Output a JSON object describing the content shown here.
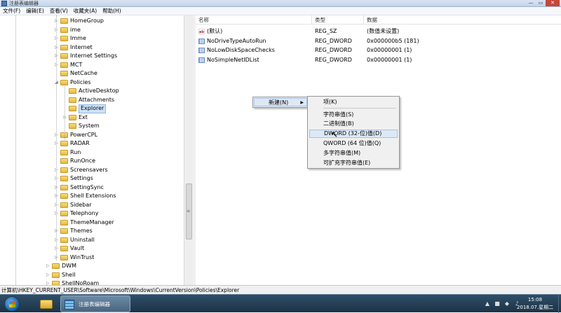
{
  "window": {
    "title": "注册表编辑器",
    "min": "—",
    "max": "▭",
    "close": "✕"
  },
  "menu": [
    "文件(F)",
    "编辑(E)",
    "查看(V)",
    "收藏夹(A)",
    "帮助(H)"
  ],
  "tree": {
    "items": [
      {
        "label": "HomeGroup",
        "level": 0,
        "expandable": true
      },
      {
        "label": "ime",
        "level": 0,
        "expandable": true
      },
      {
        "label": "Imme",
        "level": 0,
        "expandable": true
      },
      {
        "label": "Internet",
        "level": 0,
        "expandable": true
      },
      {
        "label": "Internet Settings",
        "level": 0,
        "expandable": true
      },
      {
        "label": "MCT",
        "level": 0,
        "expandable": true
      },
      {
        "label": "NetCache",
        "level": 0,
        "expandable": false
      },
      {
        "label": "Policies",
        "level": 0,
        "expandable": true,
        "expanded": true
      },
      {
        "label": "ActiveDesktop",
        "level": 1,
        "expandable": false
      },
      {
        "label": "Attachments",
        "level": 1,
        "expandable": false
      },
      {
        "label": "Explorer",
        "level": 1,
        "expandable": false,
        "selected": true
      },
      {
        "label": "Ext",
        "level": 1,
        "expandable": true
      },
      {
        "label": "System",
        "level": 1,
        "expandable": false
      },
      {
        "label": "PowerCPL",
        "level": 0,
        "expandable": true
      },
      {
        "label": "RADAR",
        "level": 0,
        "expandable": true
      },
      {
        "label": "Run",
        "level": 0,
        "expandable": false
      },
      {
        "label": "RunOnce",
        "level": 0,
        "expandable": false
      },
      {
        "label": "Screensavers",
        "level": 0,
        "expandable": true
      },
      {
        "label": "Settings",
        "level": 0,
        "expandable": true
      },
      {
        "label": "SettingSync",
        "level": 0,
        "expandable": true
      },
      {
        "label": "Shell Extensions",
        "level": 0,
        "expandable": true
      },
      {
        "label": "Sidebar",
        "level": 0,
        "expandable": true
      },
      {
        "label": "Telephony",
        "level": 0,
        "expandable": true
      },
      {
        "label": "ThemeManager",
        "level": 0,
        "expandable": false
      },
      {
        "label": "Themes",
        "level": 0,
        "expandable": true
      },
      {
        "label": "Uninstall",
        "level": 0,
        "expandable": true
      },
      {
        "label": "Vault",
        "level": 0,
        "expandable": true
      },
      {
        "label": "WinTrust",
        "level": 0,
        "expandable": true
      },
      {
        "label": "DWM",
        "level": -1,
        "expandable": true
      },
      {
        "label": "Shell",
        "level": -1,
        "expandable": true
      },
      {
        "label": "ShellNoRoam",
        "level": -1,
        "expandable": true
      }
    ]
  },
  "list": {
    "headers": {
      "name": "名称",
      "type": "类型",
      "data": "数据"
    },
    "rows": [
      {
        "icon": "ab",
        "name": "(默认)",
        "type": "REG_SZ",
        "data": "(数值未设置)"
      },
      {
        "icon": "dword",
        "name": "NoDriveTypeAutoRun",
        "type": "REG_DWORD",
        "data": "0x000000b5 (181)"
      },
      {
        "icon": "dword",
        "name": "NoLowDiskSpaceChecks",
        "type": "REG_DWORD",
        "data": "0x00000001 (1)"
      },
      {
        "icon": "dword",
        "name": "NoSimpleNetIDList",
        "type": "REG_DWORD",
        "data": "0x00000001 (1)"
      }
    ]
  },
  "context_menu": {
    "new_label": "新建(N)",
    "arrow": "▶"
  },
  "submenu": {
    "items": [
      {
        "label": "项(K)"
      },
      {
        "label": "字符串值(S)"
      },
      {
        "label": "二进制值(B)"
      },
      {
        "label": "DWORD (32-位)值(D)",
        "hot": true
      },
      {
        "label": "QWORD (64 位)值(Q)"
      },
      {
        "label": "多字符串值(M)"
      },
      {
        "label": "可扩充字符串值(E)"
      }
    ]
  },
  "statusbar": {
    "path": "计算机\\HKEY_CURRENT_USER\\Software\\Microsoft\\Windows\\CurrentVersion\\Policies\\Explorer"
  },
  "taskbar": {
    "regedit_label": "注册表编辑器",
    "time": "15:08",
    "date": "2018.07.星期二",
    "tray_icons": [
      "▲",
      "■",
      "◆",
      "♪"
    ]
  }
}
